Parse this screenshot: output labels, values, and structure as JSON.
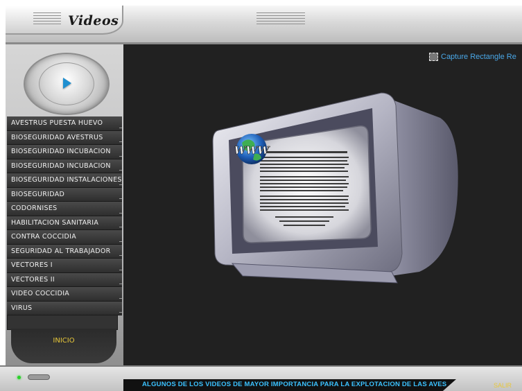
{
  "header": {
    "title": "Videos"
  },
  "capture": {
    "label": "Capture Rectangle Re",
    "icon": "capture-rectangle-icon"
  },
  "menu": {
    "items": [
      {
        "label": "AVESTRUS PUESTA HUEVO"
      },
      {
        "label": "BIOSEGURIDAD AVESTRUS"
      },
      {
        "label": "BIOSEGURIDAD INCUBACION"
      },
      {
        "label": "BIOSEGURIDAD INCUBACION"
      },
      {
        "label": "BIOSEGURIDAD INSTALACIONES"
      },
      {
        "label": "BIOSEGURIDAD"
      },
      {
        "label": "CODORNISES"
      },
      {
        "label": "HABILITACION SANITARIA"
      },
      {
        "label": "CONTRA COCCIDIA"
      },
      {
        "label": "SEGURIDAD AL TRABAJADOR"
      },
      {
        "label": "VECTORES I"
      },
      {
        "label": "VECTORES II"
      },
      {
        "label": "VIDEO COCCIDIA"
      },
      {
        "label": "VIRUS"
      }
    ],
    "inicio_label": "INICIO"
  },
  "screen": {
    "logo_text": "WWW"
  },
  "footer": {
    "ticker": "ALGUNOS DE LOS VIDEOS DE MAYOR IMPORTANCIA  PARA LA EXPLOTACION  DE LAS AVES",
    "exit_label": "SALIR"
  },
  "colors": {
    "accent": "#3bc2ff",
    "inicio": "#e8c83a",
    "stage": "#212121"
  }
}
